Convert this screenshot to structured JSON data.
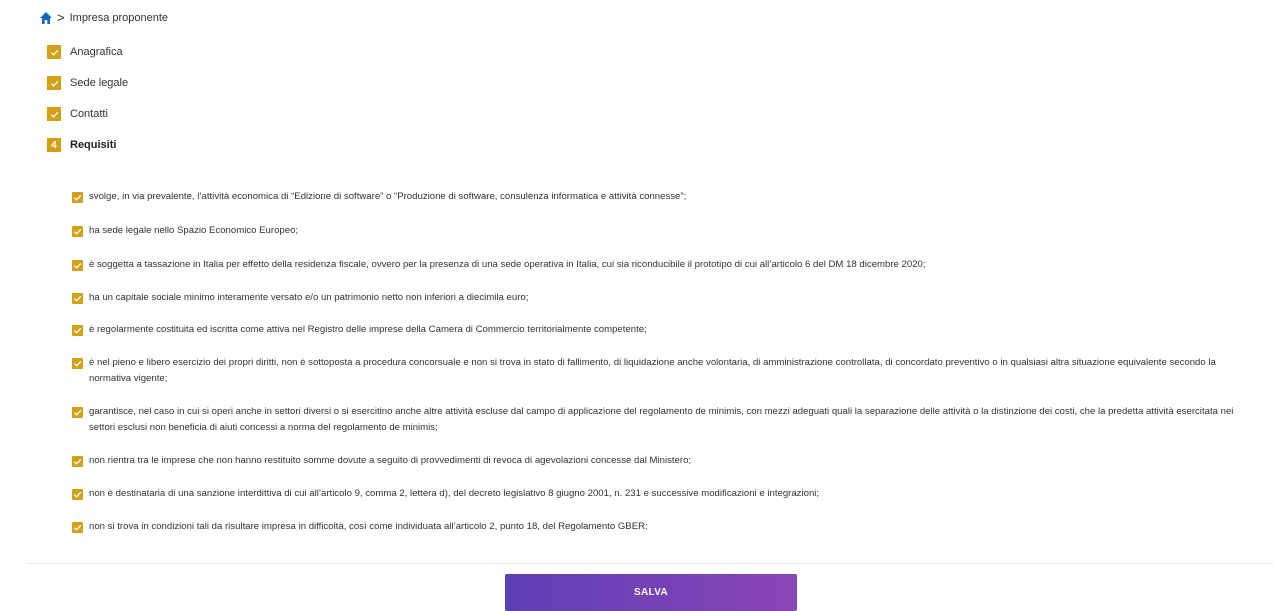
{
  "breadcrumb": {
    "separator": ">",
    "current": "Impresa proponente"
  },
  "steps": [
    {
      "label": "Anagrafica",
      "status": "completed"
    },
    {
      "label": "Sede legale",
      "status": "completed"
    },
    {
      "label": "Contatti",
      "status": "completed"
    },
    {
      "label": "Requisiti",
      "status": "active",
      "number": "4"
    }
  ],
  "requirements": [
    {
      "text": "svolge, in via prevalente, l’attività economica di “Edizione di software” o “Produzione di software, consulenza informatica e attività connesse”;",
      "checked": true
    },
    {
      "text": "ha sede legale nello Spazio Economico Europeo;",
      "checked": true
    },
    {
      "text": "è soggetta a tassazione in Italia per effetto della residenza fiscale, ovvero per la presenza di una sede operativa in Italia, cui sia riconducibile il prototipo di cui all’articolo 6 del DM 18 dicembre 2020;",
      "checked": true
    },
    {
      "text": "ha un capitale sociale minimo interamente versato e/o un patrimonio netto non inferiori a diecimila euro;",
      "checked": true
    },
    {
      "text": "è regolarmente costituita ed iscritta come attiva nel Registro delle imprese della Camera di Commercio territorialmente competente;",
      "checked": true
    },
    {
      "text": "è nel pieno e libero esercizio dei propri diritti, non è sottoposta a procedura concorsuale e non si trova in stato di fallimento, di liquidazione anche volontaria, di amministrazione controllata, di concordato preventivo o in qualsiasi altra situazione equivalente secondo la normativa vigente;",
      "checked": true
    },
    {
      "text": "garantisce, nel caso in cui si operi anche in settori diversi o si esercitino anche altre attività escluse dal campo di applicazione del regolamento de minimis, con mezzi adeguati quali la separazione delle attività o la distinzione dei costi, che la predetta attività esercitata nei settori esclusi non beneficia di aiuti concessi a norma del regolamento de minimis;",
      "checked": true
    },
    {
      "text": "non rientra tra le imprese che non hanno restituito somme dovute a seguito di provvedimenti di revoca di agevolazioni concesse dal Ministero;",
      "checked": true
    },
    {
      "text": "non è destinataria di una sanzione interdittiva di cui all’articolo 9, comma 2, lettera d), del decreto legislativo 8 giugno 2001, n. 231 e successive modificazioni e integrazioni;",
      "checked": true
    },
    {
      "text": "non si trova in condizioni tali da risultare impresa in difficoltà, così come individuata all’articolo 2, punto 18, del Regolamento GBER;",
      "checked": true
    }
  ],
  "save_label": "SALVA",
  "colors": {
    "accent": "#d4a017",
    "home_icon": "#1565c0",
    "button_gradient_start": "#5e3fb5",
    "button_gradient_end": "#8b45b8"
  }
}
